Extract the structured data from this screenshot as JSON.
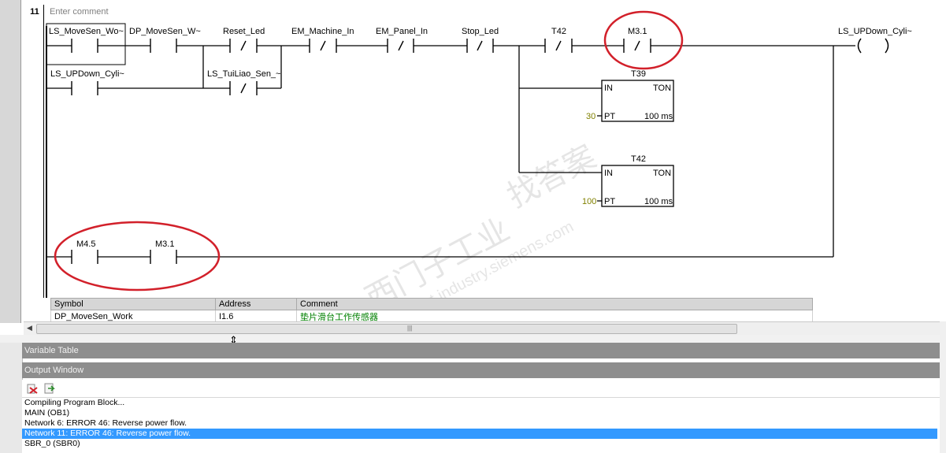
{
  "editor": {
    "network_number": "11",
    "comment_placeholder": "Enter comment",
    "rung1": {
      "contacts": [
        {
          "symbol": "LS_MoveSen_Wo~",
          "type": "NO"
        },
        {
          "symbol": "DP_MoveSen_W~",
          "type": "NO"
        },
        {
          "symbol": "Reset_Led",
          "type": "NC"
        },
        {
          "symbol": "EM_Machine_In",
          "type": "NC"
        },
        {
          "symbol": "EM_Panel_In",
          "type": "NC"
        },
        {
          "symbol": "Stop_Led",
          "type": "NC"
        },
        {
          "symbol": "T42",
          "type": "NC"
        },
        {
          "symbol": "M3.1",
          "type": "NC"
        }
      ],
      "branch_contacts": [
        {
          "symbol": "LS_UPDown_Cyli~",
          "type": "NO"
        },
        {
          "symbol": "LS_TuiLiao_Sen_~",
          "type": "NC"
        }
      ],
      "coil": {
        "symbol": "LS_UPDown_Cyli~"
      },
      "timers": [
        {
          "name": "T39",
          "type_label": "TON",
          "in_label": "IN",
          "pt_label": "PT",
          "preset": "30",
          "resolution": "100 ms"
        },
        {
          "name": "T42",
          "type_label": "TON",
          "in_label": "IN",
          "pt_label": "PT",
          "preset": "100",
          "resolution": "100 ms"
        }
      ]
    },
    "rung2": {
      "contacts": [
        {
          "symbol": "M4.5",
          "type": "NO"
        },
        {
          "symbol": "M3.1",
          "type": "NO"
        }
      ]
    },
    "symbol_table": {
      "headers": [
        "Symbol",
        "Address",
        "Comment"
      ],
      "rows": [
        {
          "symbol": "DP_MoveSen_Work",
          "address": "I1.6",
          "comment": "垫片滑台工作传感器"
        }
      ]
    },
    "watermark": "西门子工业 support.industry.siemens.com 找答案",
    "annotation_color": "#d2202a",
    "comment_text_color": "#008000",
    "preset_color": "#808000"
  },
  "panels": {
    "variable_table": "Variable Table",
    "output_window": "Output Window"
  },
  "output_toolbar": {
    "icons": [
      "clear-icon",
      "export-icon"
    ]
  },
  "output_lines": [
    "Compiling Program Block...",
    "MAIN (OB1)",
    "Network 6: ERROR 46: Reverse power flow.",
    "Network 11: ERROR 46: Reverse power flow.",
    "SBR_0 (SBR0)"
  ],
  "selected_output_index": 3,
  "selection_color": "#3399ff"
}
